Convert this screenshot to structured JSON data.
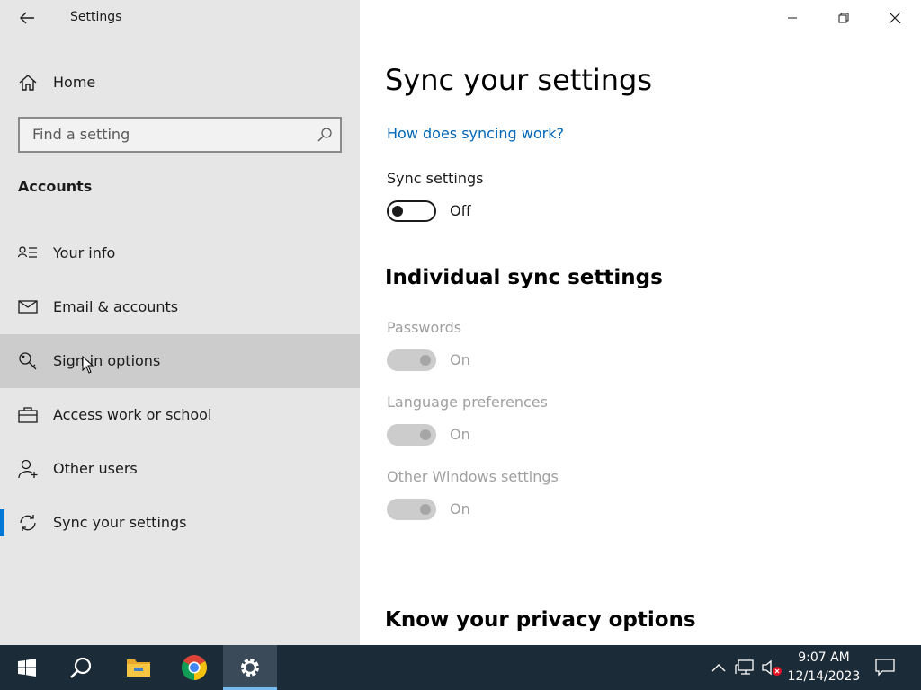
{
  "window": {
    "title": "Settings"
  },
  "sidebar": {
    "home_label": "Home",
    "search_placeholder": "Find a setting",
    "section": "Accounts",
    "items": [
      {
        "label": "Your info",
        "icon": "contact-card-icon"
      },
      {
        "label": "Email & accounts",
        "icon": "mail-icon"
      },
      {
        "label": "Sign-in options",
        "icon": "key-icon"
      },
      {
        "label": "Access work or school",
        "icon": "briefcase-icon"
      },
      {
        "label": "Other users",
        "icon": "add-user-icon"
      },
      {
        "label": "Sync your settings",
        "icon": "sync-icon"
      }
    ],
    "hovered_item": "Sign-in options",
    "active_item": "Sync your settings"
  },
  "main": {
    "title": "Sync your settings",
    "help_link": "How does syncing work?",
    "sync": {
      "label": "Sync settings",
      "state": "Off"
    },
    "individual_title": "Individual sync settings",
    "individual": [
      {
        "label": "Passwords",
        "state": "On",
        "enabled": false
      },
      {
        "label": "Language preferences",
        "state": "On",
        "enabled": false
      },
      {
        "label": "Other Windows settings",
        "state": "On",
        "enabled": false
      }
    ],
    "privacy_title": "Know your privacy options"
  },
  "taskbar": {
    "time": "9:07 AM",
    "date": "12/14/2023",
    "apps": [
      "start-icon",
      "search-icon",
      "file-explorer-icon",
      "chrome-icon",
      "settings-icon"
    ]
  },
  "colors": {
    "accent": "#0078d7",
    "link": "#0067b8",
    "taskbar": "#1c2b38"
  }
}
